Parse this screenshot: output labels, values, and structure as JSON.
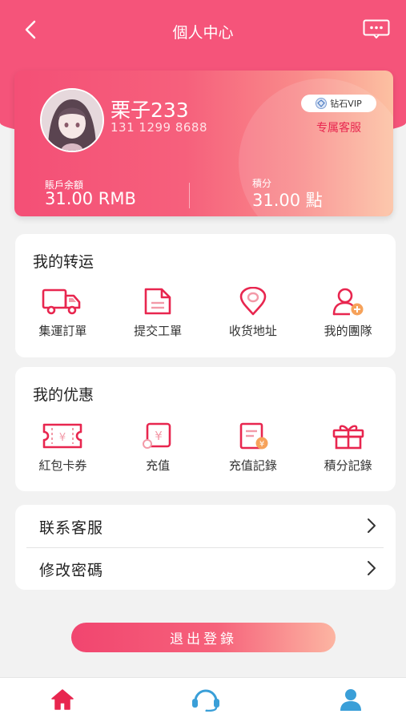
{
  "header": {
    "title": "個人中心"
  },
  "profile": {
    "name": "栗子233",
    "phone": "131 1299 8688",
    "vip_label": "钻石VIP",
    "service_label": "专属客服",
    "balance_label": "賬戶余額",
    "balance_value": "31.00 RMB",
    "points_label": "積分",
    "points_value": "31.00 點"
  },
  "shipping": {
    "title": "我的转运",
    "items": [
      {
        "label": "集運訂單",
        "icon": "truck-icon"
      },
      {
        "label": "提交工單",
        "icon": "document-icon"
      },
      {
        "label": "收货地址",
        "icon": "location-pin-icon"
      },
      {
        "label": "我的團隊",
        "icon": "add-user-icon"
      }
    ]
  },
  "offers": {
    "title": "我的优惠",
    "items": [
      {
        "label": "紅包卡券",
        "icon": "coupon-icon"
      },
      {
        "label": "充值",
        "icon": "recharge-icon"
      },
      {
        "label": "充值記錄",
        "icon": "recharge-record-icon"
      },
      {
        "label": "積分記錄",
        "icon": "gift-icon"
      }
    ]
  },
  "menu": [
    {
      "label": "联系客服"
    },
    {
      "label": "修改密碼"
    }
  ],
  "logout_label": "退出登錄",
  "tabs": [
    {
      "icon": "home-icon"
    },
    {
      "icon": "headset-icon"
    },
    {
      "icon": "user-icon"
    }
  ],
  "colors": {
    "accent": "#f5547a",
    "icon_red": "#e8264f",
    "tab_blue": "#3a9fd8"
  }
}
